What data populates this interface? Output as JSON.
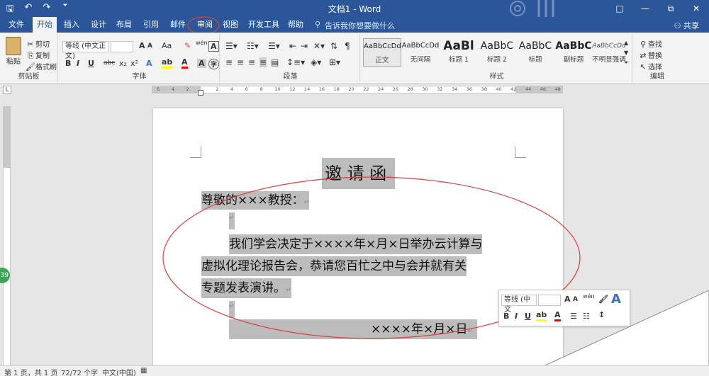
{
  "window": {
    "title": "文档1 - Word"
  },
  "qat": {
    "save_icon": "save-icon",
    "undo_icon": "undo-icon",
    "redo_icon": "redo-icon",
    "customize_icon": "customize-qat-icon"
  },
  "window_controls": {
    "ribbon_options": "□",
    "minimize": "—",
    "restore": "⧉",
    "close": "✕"
  },
  "tabs": [
    "文件",
    "开始",
    "插入",
    "设计",
    "布局",
    "引用",
    "邮件",
    "审阅",
    "视图",
    "开发工具",
    "帮助"
  ],
  "tellme": "告诉我你想要做什么",
  "share": "共享",
  "clipboard": {
    "paste": "粘贴",
    "cut": "剪切",
    "copy": "复制",
    "format_painter": "格式刷",
    "label": "剪贴板"
  },
  "font": {
    "name": "等线 (中文正文)",
    "size": "",
    "label": "字体",
    "grow": "A",
    "shrink": "A",
    "case": "Aa",
    "bold": "B",
    "italic": "I",
    "underline": "U",
    "strike": "abc",
    "sub": "x₂",
    "sup": "x²"
  },
  "paragraph": {
    "label": "段落"
  },
  "styles": {
    "label": "样式",
    "items": [
      {
        "preview": "AaBbCcDd",
        "name": "正文"
      },
      {
        "preview": "AaBbCcDd",
        "name": "无间隔"
      },
      {
        "preview": "AaBl",
        "name": "标题 1"
      },
      {
        "preview": "AaBbC",
        "name": "标题 2"
      },
      {
        "preview": "AaBbC",
        "name": "标题"
      },
      {
        "preview": "AaBbC",
        "name": "副标题"
      },
      {
        "preview": "AaBbCcDd",
        "name": "不明显强调"
      }
    ]
  },
  "editing": {
    "find": "查找",
    "replace": "替换",
    "select": "选择",
    "label": "编辑"
  },
  "ruler": {
    "ticks": [
      "6",
      "4",
      "2",
      "",
      "2",
      "4",
      "6",
      "8",
      "10",
      "12",
      "14",
      "16",
      "18",
      "20",
      "22",
      "24",
      "26",
      "28",
      "30",
      "32",
      "34",
      "36",
      "38",
      "40",
      "42",
      "44",
      "46",
      "48"
    ]
  },
  "document": {
    "title": "邀 请 函",
    "salutation": "尊敬的×××教授：",
    "body_line1": "我们学会决定于××××年×月×日举办云计算与",
    "body_line2": "虚拟化理论报告会，恭请您百忙之中与会并就有关",
    "body_line3": "专题发表演讲。",
    "date": "××××年×月×日"
  },
  "mini_toolbar": {
    "font": "等线 (中文",
    "size": ""
  },
  "statusbar": {
    "page": "第 1 页，共 1 页",
    "words": "72/72 个字",
    "lang": "中文(中国)"
  },
  "badge": "39",
  "colors": {
    "accent": "#2b579a",
    "annotation": "#d94040",
    "highlight": "#bcbcbc"
  }
}
